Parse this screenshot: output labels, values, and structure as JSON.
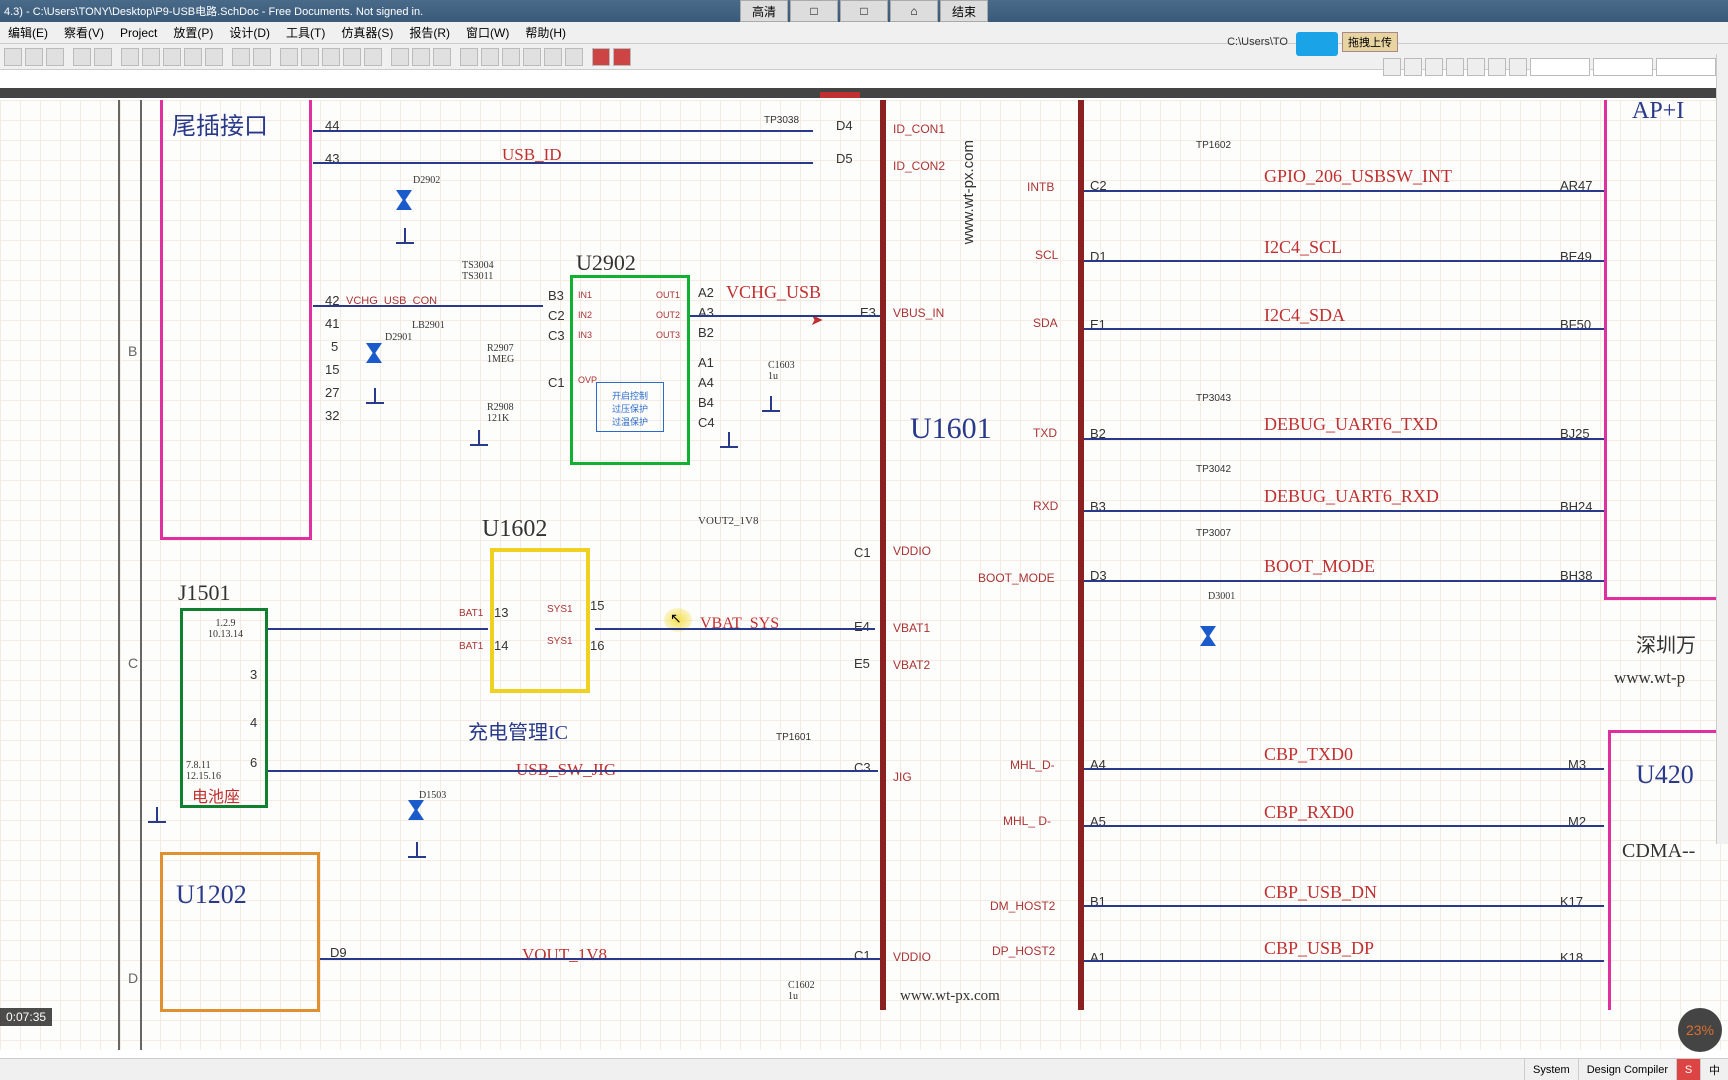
{
  "title": "4.3) - C:\\Users\\TONY\\Desktop\\P9-USB电路.SchDoc - Free Documents. Not signed in.",
  "menu": {
    "edit": "编辑(E)",
    "view": "察看(V)",
    "project": "Project",
    "place": "放置(P)",
    "design": "设计(D)",
    "tools": "工具(T)",
    "sim": "仿真器(S)",
    "report": "报告(R)",
    "window": "窗口(W)",
    "help": "帮助(H)"
  },
  "overlay": {
    "b1": "高清",
    "b2": "□",
    "b3": "□",
    "b4": "⌂",
    "b5": "结束"
  },
  "right_url": "C:\\Users\\TO",
  "right_btn": "拖拽上传",
  "video_time": "0:07:35",
  "pct": "23%",
  "status": {
    "s1": "System",
    "s2": "Design Compiler",
    "s3": "中"
  },
  "row_lbl": {
    "b": "B",
    "c": "C",
    "d": "D"
  },
  "main_ic": "U1601",
  "u2902": "U2902",
  "u1602": "U1602",
  "u1602_sub": "充电管理IC",
  "j1501": "J1501",
  "u1202": "U1202",
  "u4200": "U420",
  "u4200_sub": "CDMA--",
  "ap": "AP+I",
  "tail": "尾插接口",
  "batt": "电池座",
  "j1501_p1": "1.2.9\n10.13.14",
  "j1501_p2": "7.8.11\n12.15.16",
  "shenzhen": "深圳万",
  "wtpx": "www.wt-p",
  "wtpx2": "www.wt-px.com",
  "wtpx3": "www.wt-px.com",
  "nets": {
    "usb_id": "USB_ID",
    "vchg_usb": "VCHG_USB",
    "vchg_con": "VCHG_USB_CON",
    "vbat_sys": "VBAT_SYS",
    "usb_sw": "USB_SW_JIG",
    "vout": "VOUT_1V8",
    "vout2": "VOUT2_1V8",
    "id_con1": "ID_CON1",
    "id_con2": "ID_CON2",
    "intb": "INTB",
    "scl": "SCL",
    "sda": "SDA",
    "vbus_in": "VBUS_IN",
    "txd": "TXD",
    "rxd": "RXD",
    "vddio": "VDDIO",
    "boot": "BOOT_MODE",
    "vbat1": "VBAT1",
    "vbat2": "VBAT2",
    "jig": "JIG",
    "mhl_d_n": "MHL_D-",
    "mhl_d_p": "MHL_ D-",
    "dm_host2": "DM_HOST2",
    "dp_host2": "DP_HOST2",
    "vddio2": "VDDIO",
    "gpio206": "GPIO_206_USBSW_INT",
    "i2c4_scl": "I2C4_SCL",
    "i2c4_sda": "I2C4_SDA",
    "dbg_txd": "DEBUG_UART6_TXD",
    "dbg_rxd": "DEBUG_UART6_RXD",
    "boot_mode": "BOOT_MODE",
    "cbp_txd": "CBP_TXD0",
    "cbp_rxd": "CBP_RXD0",
    "cbp_dn": "CBP_USB_DN",
    "cbp_dp": "CBP_USB_DP"
  },
  "pins_left": [
    "44",
    "43",
    "42",
    "41",
    "5",
    "15",
    "27",
    "32"
  ],
  "pins_a": [
    "A2",
    "A3",
    "B2",
    "A1",
    "A4",
    "B4",
    "C4"
  ],
  "pins_b": [
    "B3",
    "C2",
    "C3",
    "C1"
  ],
  "pins_d": [
    "D4",
    "D5"
  ],
  "u1602_p": {
    "13": "13",
    "14": "14",
    "15": "15",
    "16": "16"
  },
  "bat": "BAT1",
  "sys": "SYS1",
  "j1501_3": "3",
  "j1501_4": "4",
  "j1501_6": "6",
  "u1601_left": [
    {
      "p": "C2",
      "px": "AR47"
    },
    {
      "p": "D1",
      "px": "BE49"
    },
    {
      "p": "E1",
      "px": "BF50"
    },
    {
      "p": "E3"
    },
    {
      "p": "B2",
      "px": "BJ25"
    },
    {
      "p": "B3",
      "px": "BH24"
    },
    {
      "p": "C1"
    },
    {
      "p": "D3",
      "px": "BH38"
    },
    {
      "p": "E4"
    },
    {
      "p": "E5"
    },
    {
      "p": "C3"
    },
    {
      "p": "A4",
      "px": "M3"
    },
    {
      "p": "A5",
      "px": "M2"
    },
    {
      "p": "B1",
      "px": "K17"
    },
    {
      "p": "A1",
      "px": "K18"
    },
    {
      "p": "C1"
    }
  ],
  "d9": "D9",
  "comp": {
    "d2902": "D2902",
    "d2901": "D2901",
    "d1503": "D1503",
    "d3001": "D3001",
    "lb2901": "LB2901",
    "r2907": "R2907\n1MEG",
    "r2908": "R2908\n121K",
    "ts": "TS3004\nTS3011",
    "c1603": "C1603\n1u",
    "c1602": "C1602\n1u",
    "ovp": "OVP",
    "in1": "IN1",
    "in2": "IN2",
    "in3": "IN3",
    "out1": "OUT1",
    "out2": "OUT2",
    "out3": "OUT3",
    "note": "开启控制\n过压保护\n过温保护"
  },
  "tp": {
    "tp3038": "TP3038",
    "tp1602": "TP1602",
    "tp3043": "TP3043",
    "tp3042": "TP3042",
    "tp3007": "TP3007",
    "tp1601": "TP1601"
  }
}
